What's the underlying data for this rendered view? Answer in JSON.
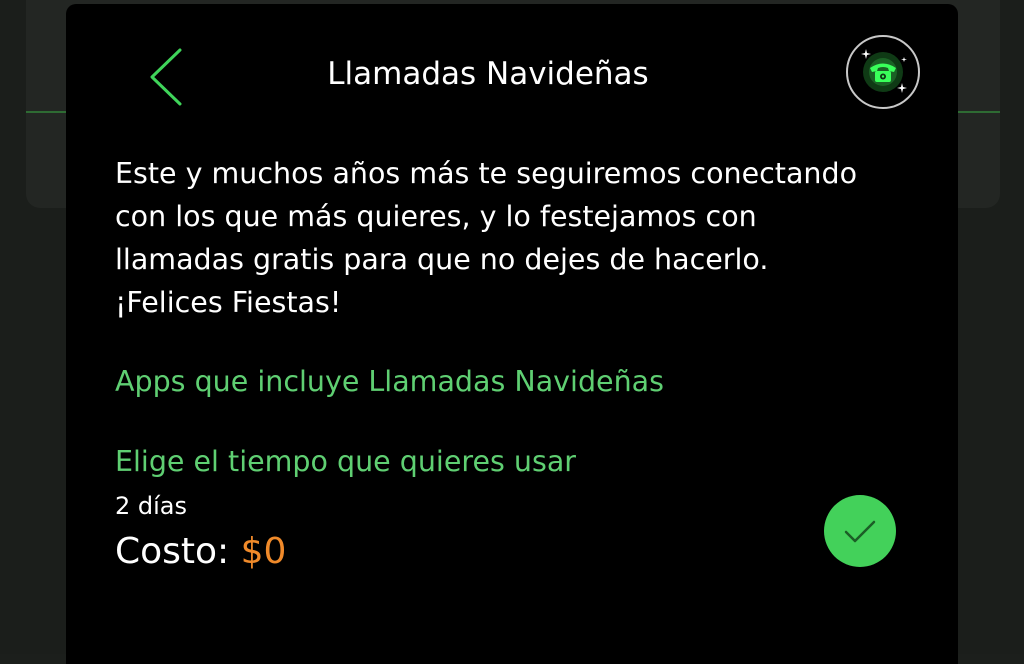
{
  "header": {
    "title": "Llamadas Navideñas",
    "back_icon": "chevron-left-icon",
    "badge_icon": "sparkling-phone-icon"
  },
  "content": {
    "description": "Este y muchos años más te seguiremos conectando\ncon los que más quieres, y lo festejamos con\nllamadas gratis para que no dejes de hacerlo.\n¡Felices Fiestas!",
    "apps_link": "Apps que incluye Llamadas Navideñas",
    "choose_label": "Elige el tiempo que quieres usar",
    "duration": "2 días",
    "cost_label": "Costo:",
    "cost_value": "$0",
    "check_icon": "checkmark-icon"
  },
  "colors": {
    "accent_green": "#43d15a",
    "link_green": "#5fcf72",
    "price_orange": "#f08a2a",
    "background": "#000000"
  }
}
